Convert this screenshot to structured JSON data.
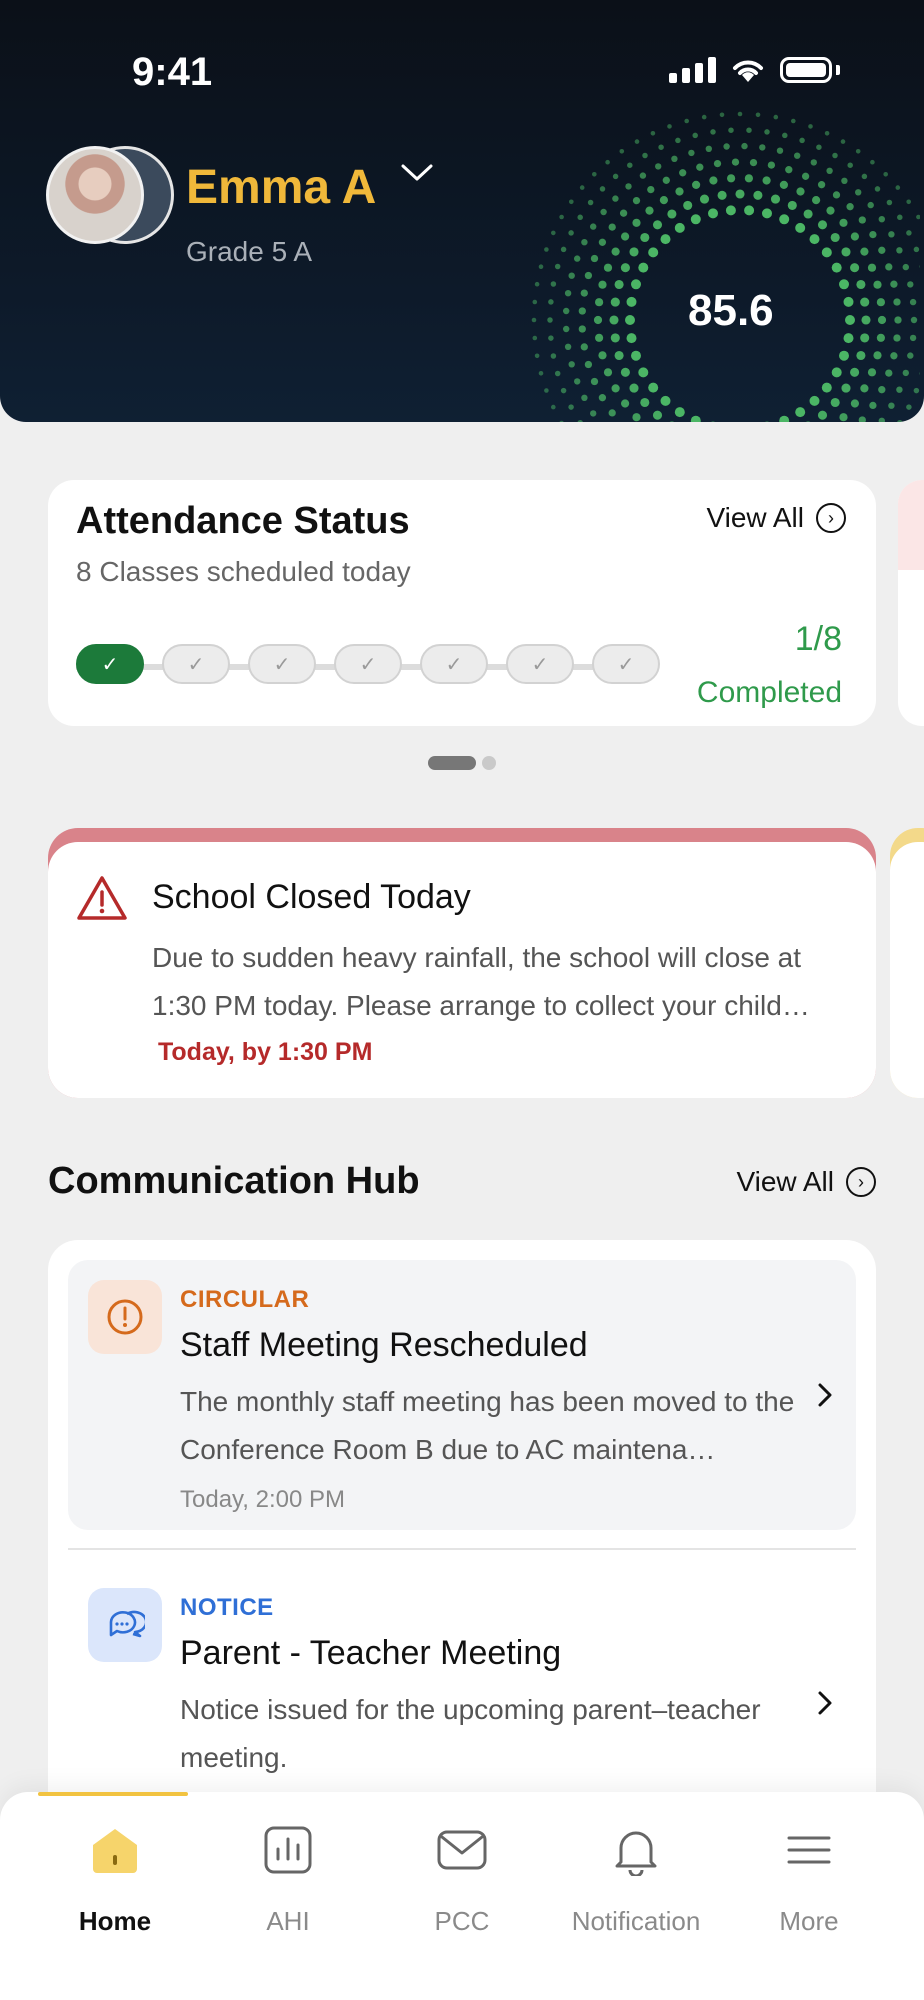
{
  "status_bar": {
    "time": "9:41"
  },
  "profile": {
    "name": "Emma A",
    "grade": "Grade 5 A",
    "score": "85.6"
  },
  "attendance": {
    "title": "Attendance Status",
    "subtitle": "8 Classes scheduled today",
    "view_all": "View All",
    "completed_count": "1/8",
    "completed_label": "Completed",
    "classes_total": 8,
    "classes_completed": 1
  },
  "alert": {
    "title": "School Closed Today",
    "body": "Due to sudden heavy rainfall, the school will close at 1:30 PM today. Please arrange to collect your child…",
    "time": "Today, by 1:30 PM",
    "accent_color": "#d9838a"
  },
  "hub": {
    "title": "Communication Hub",
    "view_all": "View All",
    "messages": [
      {
        "type": "CIRCULAR",
        "title": "Staff Meeting Rescheduled",
        "body": "The monthly staff meeting has been moved to the Conference Room B due to AC maintena…",
        "time": "Today, 2:00 PM",
        "icon": "alert-circle-icon",
        "color": "#d56a1c"
      },
      {
        "type": "NOTICE",
        "title": "Parent - Teacher Meeting",
        "body": "Notice issued for the upcoming parent–teacher meeting.",
        "icon": "chat-bubbles-icon",
        "color": "#2f6fd6"
      }
    ]
  },
  "tabbar": {
    "items": [
      {
        "label": "Home",
        "icon": "home-icon",
        "active": true
      },
      {
        "label": "AHI",
        "icon": "bar-chart-icon"
      },
      {
        "label": "PCC",
        "icon": "mail-icon"
      },
      {
        "label": "Notification",
        "icon": "bell-icon"
      },
      {
        "label": "More",
        "icon": "menu-icon"
      }
    ]
  }
}
